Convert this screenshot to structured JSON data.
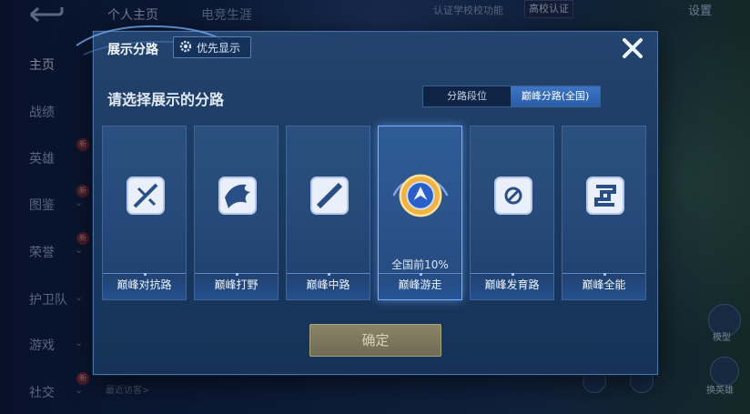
{
  "background": {
    "tabs": [
      "个人主页",
      "电竞生涯"
    ],
    "top_right": {
      "certify": "认证学校校功能",
      "badge": "高校认证",
      "settings": "设置"
    },
    "sidebar": [
      {
        "label": "主页",
        "chev": "",
        "new": false
      },
      {
        "label": "战绩",
        "chev": "",
        "new": false
      },
      {
        "label": "英雄",
        "chev": "",
        "new": true
      },
      {
        "label": "图鉴",
        "chev": "⌄",
        "new": true
      },
      {
        "label": "荣誉",
        "chev": "⌄",
        "new": true
      },
      {
        "label": "护卫队",
        "chev": "⌄",
        "new": false
      },
      {
        "label": "游戏",
        "chev": "⌄",
        "new": false
      },
      {
        "label": "社交",
        "chev": "⌄",
        "new": true
      }
    ],
    "new_badge": "新",
    "recent_visitors": "最近访客>",
    "right_labels": {
      "skin": "模型",
      "swap": "换英雄"
    }
  },
  "dialog": {
    "title": "展示分路",
    "priority_label": "优先显示",
    "subtitle": "请选择展示的分路",
    "segments": [
      "分路段位",
      "巅峰分路(全国)"
    ],
    "active_segment": 1,
    "cards": [
      {
        "name": "巅峰对抗路",
        "icon": "sword-lane-icon",
        "rank": "",
        "selected": false
      },
      {
        "name": "巅峰打野",
        "icon": "dragon-jungle-icon",
        "rank": "",
        "selected": false
      },
      {
        "name": "巅峰中路",
        "icon": "mid-lane-icon",
        "rank": "",
        "selected": false
      },
      {
        "name": "巅峰游走",
        "icon": "roam-emblem-icon",
        "rank": "全国前10%",
        "selected": true
      },
      {
        "name": "巅峰发育路",
        "icon": "bottom-lane-icon",
        "rank": "",
        "selected": false
      },
      {
        "name": "巅峰全能",
        "icon": "all-round-icon",
        "rank": "",
        "selected": false
      }
    ],
    "confirm_label": "确定"
  },
  "colors": {
    "accent": "#3b76c4",
    "dialog": "#1b3a62",
    "confirm": "#7d7860"
  }
}
